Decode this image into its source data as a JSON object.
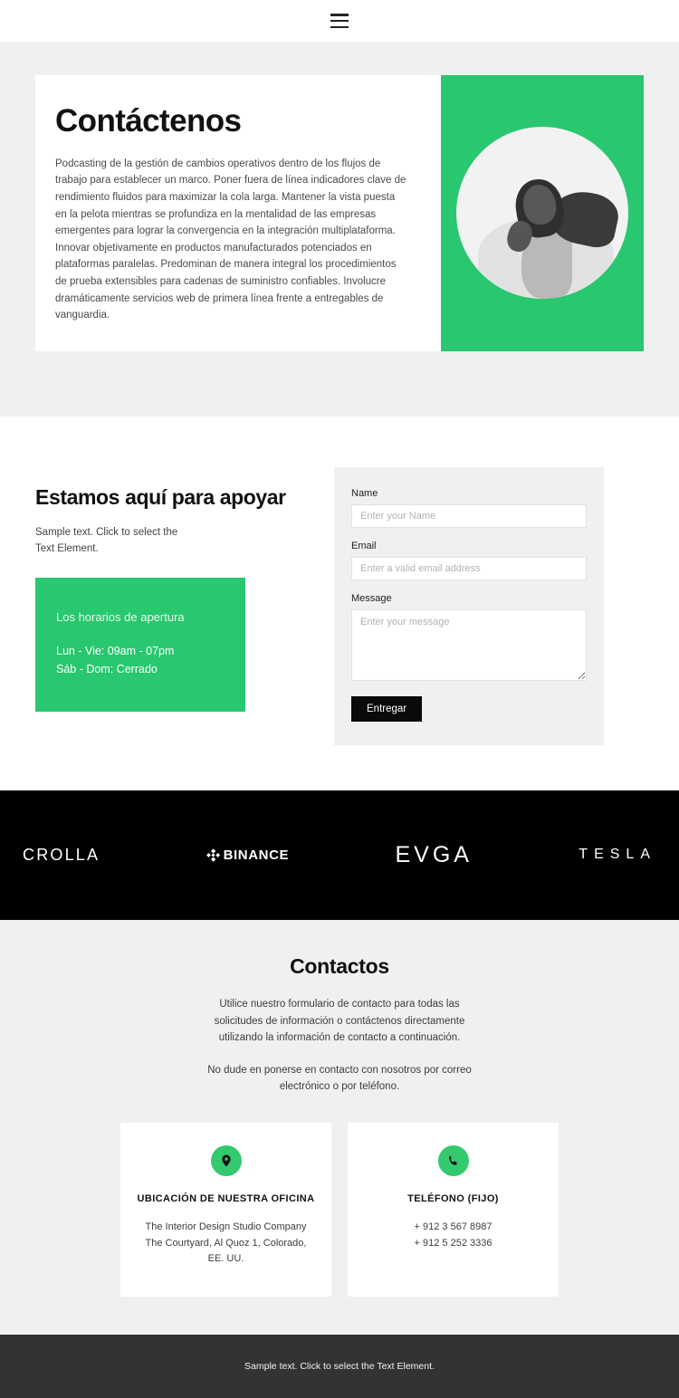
{
  "nav": {
    "menu_icon": "hamburger-menu-icon"
  },
  "colors": {
    "accent_green": "#29c76f",
    "icon_green": "#33c96f",
    "dark_band": "#000000",
    "footer": "#333333",
    "page_gray": "#f0f0f0",
    "button_black": "#0a0a0a"
  },
  "hero": {
    "title": "Contáctenos",
    "paragraph": "Podcasting de la gestión de cambios operativos dentro de los flujos de trabajo para establecer un marco. Poner fuera de línea indicadores clave de rendimiento fluidos para maximizar la cola larga. Mantener la vista puesta en la pelota mientras se profundiza en la mentalidad de las empresas emergentes para lograr la convergencia en la integración multiplataforma. Innovar objetivamente en productos manufacturados potenciados en plataformas paralelas. Predominan de manera integral los procedimientos de prueba extensibles para cadenas de suministro confiables. Involucre dramáticamente servicios web de primera línea frente a entregables de vanguardia.",
    "image_alt": "portrait-photo"
  },
  "support": {
    "title": "Estamos aquí para apoyar",
    "subtitle": "Sample text. Click to select the Text Element.",
    "hours": {
      "title": "Los horarios de apertura",
      "line1": "Lun - Vie: 09am - 07pm",
      "line2": "Sáb - Dom: Cerrado"
    }
  },
  "form": {
    "name_label": "Name",
    "name_value": "",
    "name_placeholder": "Enter your Name",
    "email_label": "Email",
    "email_value": "",
    "email_placeholder": "Enter a valid email address",
    "message_label": "Message",
    "message_value": "",
    "message_placeholder": "Enter your message",
    "submit_label": "Entregar"
  },
  "brands": [
    {
      "name": "CROLLA",
      "icon": "none"
    },
    {
      "name": "BINANCE",
      "icon": "binance-diamond-icon"
    },
    {
      "name": "EVGA",
      "icon": "none"
    },
    {
      "name": "TESLA",
      "icon": "none"
    }
  ],
  "contacts": {
    "title": "Contactos",
    "paragraph1": "Utilice nuestro formulario de contacto para todas las solicitudes de información o contáctenos directamente utilizando la información de contacto a continuación.",
    "paragraph2": "No dude en ponerse en contacto con nosotros por correo electrónico o por teléfono.",
    "cards": [
      {
        "icon": "location-pin-icon",
        "title": "UBICACIÓN DE NUESTRA OFICINA",
        "line1": "The Interior Design Studio Company",
        "line2": "The Courtyard, Al Quoz 1, Colorado,  EE. UU."
      },
      {
        "icon": "phone-icon",
        "title": "TELÉFONO (FIJO)",
        "line1": "+ 912 3 567 8987",
        "line2": "+ 912 5 252 3336"
      }
    ]
  },
  "footer": {
    "text": "Sample text. Click to select the Text Element."
  }
}
